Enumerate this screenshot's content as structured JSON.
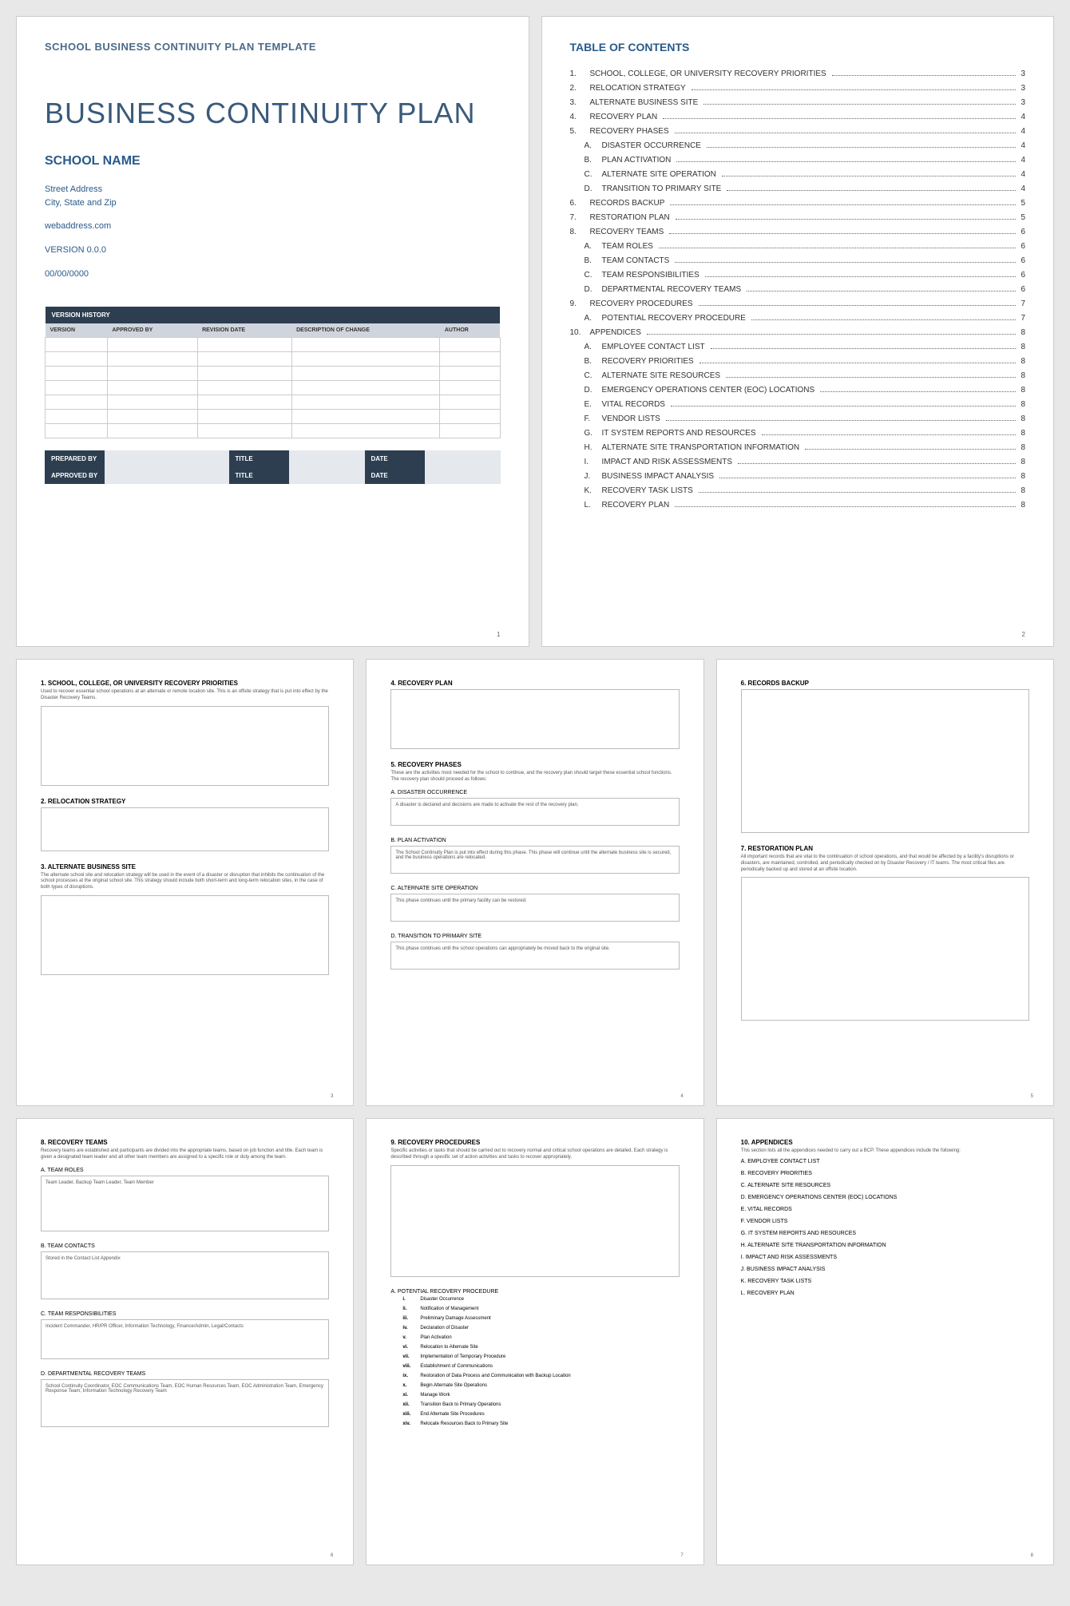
{
  "cover": {
    "template_label": "SCHOOL BUSINESS CONTINUITY PLAN TEMPLATE",
    "title": "BUSINESS CONTINUITY PLAN",
    "school_name": "SCHOOL NAME",
    "address_line1": "Street Address",
    "address_line2": "City, State and Zip",
    "web": "webaddress.com",
    "version": "VERSION 0.0.0",
    "date": "00/00/0000",
    "vh_header": "VERSION HISTORY",
    "vh_cols": [
      "VERSION",
      "APPROVED BY",
      "REVISION DATE",
      "DESCRIPTION OF CHANGE",
      "AUTHOR"
    ],
    "sig": {
      "prepared": "PREPARED BY",
      "approved": "APPROVED BY",
      "title": "TITLE",
      "date": "DATE"
    },
    "page_num": "1"
  },
  "toc": {
    "title": "TABLE OF CONTENTS",
    "items": [
      {
        "n": "1.",
        "t": "SCHOOL, COLLEGE, OR UNIVERSITY RECOVERY PRIORITIES",
        "p": "3"
      },
      {
        "n": "2.",
        "t": "RELOCATION STRATEGY",
        "p": "3"
      },
      {
        "n": "3.",
        "t": "ALTERNATE BUSINESS SITE",
        "p": "3"
      },
      {
        "n": "4.",
        "t": "RECOVERY PLAN",
        "p": "4"
      },
      {
        "n": "5.",
        "t": "RECOVERY PHASES",
        "p": "4"
      },
      {
        "n": "A.",
        "t": "DISASTER OCCURRENCE",
        "p": "4",
        "sub": true
      },
      {
        "n": "B.",
        "t": "PLAN ACTIVATION",
        "p": "4",
        "sub": true
      },
      {
        "n": "C.",
        "t": "ALTERNATE SITE OPERATION",
        "p": "4",
        "sub": true
      },
      {
        "n": "D.",
        "t": "TRANSITION TO PRIMARY SITE",
        "p": "4",
        "sub": true
      },
      {
        "n": "6.",
        "t": "RECORDS BACKUP",
        "p": "5"
      },
      {
        "n": "7.",
        "t": "RESTORATION PLAN",
        "p": "5"
      },
      {
        "n": "8.",
        "t": "RECOVERY TEAMS",
        "p": "6"
      },
      {
        "n": "A.",
        "t": "TEAM ROLES",
        "p": "6",
        "sub": true
      },
      {
        "n": "B.",
        "t": "TEAM CONTACTS",
        "p": "6",
        "sub": true
      },
      {
        "n": "C.",
        "t": "TEAM RESPONSIBILITIES",
        "p": "6",
        "sub": true
      },
      {
        "n": "D.",
        "t": "DEPARTMENTAL RECOVERY TEAMS",
        "p": "6",
        "sub": true
      },
      {
        "n": "9.",
        "t": "RECOVERY PROCEDURES",
        "p": "7"
      },
      {
        "n": "A.",
        "t": "POTENTIAL RECOVERY PROCEDURE",
        "p": "7",
        "sub": true
      },
      {
        "n": "10.",
        "t": "APPENDICES",
        "p": "8"
      },
      {
        "n": "A.",
        "t": "EMPLOYEE CONTACT LIST",
        "p": "8",
        "sub": true
      },
      {
        "n": "B.",
        "t": "RECOVERY PRIORITIES",
        "p": "8",
        "sub": true
      },
      {
        "n": "C.",
        "t": "ALTERNATE SITE RESOURCES",
        "p": "8",
        "sub": true
      },
      {
        "n": "D.",
        "t": "EMERGENCY OPERATIONS CENTER (EOC) LOCATIONS",
        "p": "8",
        "sub": true
      },
      {
        "n": "E.",
        "t": "VITAL RECORDS",
        "p": "8",
        "sub": true
      },
      {
        "n": "F.",
        "t": "VENDOR LISTS",
        "p": "8",
        "sub": true
      },
      {
        "n": "G.",
        "t": "IT SYSTEM REPORTS AND RESOURCES",
        "p": "8",
        "sub": true
      },
      {
        "n": "H.",
        "t": "ALTERNATE SITE TRANSPORTATION INFORMATION",
        "p": "8",
        "sub": true
      },
      {
        "n": "I.",
        "t": "IMPACT AND RISK ASSESSMENTS",
        "p": "8",
        "sub": true
      },
      {
        "n": "J.",
        "t": "BUSINESS IMPACT ANALYSIS",
        "p": "8",
        "sub": true
      },
      {
        "n": "K.",
        "t": "RECOVERY TASK LISTS",
        "p": "8",
        "sub": true
      },
      {
        "n": "L.",
        "t": "RECOVERY PLAN",
        "p": "8",
        "sub": true
      }
    ],
    "page_num": "2"
  },
  "p3": {
    "s1_title": "1. SCHOOL, COLLEGE, OR UNIVERSITY RECOVERY PRIORITIES",
    "s1_desc": "Used to recover essential school operations at an alternate or remote location site. This is an offsite strategy that is put into effect by the Disaster Recovery Teams.",
    "s2_title": "2. RELOCATION STRATEGY",
    "s3_title": "3. ALTERNATE BUSINESS SITE",
    "s3_desc": "The alternate school site and relocation strategy will be used in the event of a disaster or disruption that inhibits the continuation of the school processes at the original school site. This strategy should include both short-term and long-term relocation sites, in the case of both types of disruptions.",
    "page_num": "3"
  },
  "p4": {
    "s4_title": "4. RECOVERY PLAN",
    "s5_title": "5. RECOVERY PHASES",
    "s5_desc": "These are the activities most needed for the school to continue, and the recovery plan should target these essential school functions. The recovery plan should proceed as follows:",
    "a_title": "A. DISASTER OCCURRENCE",
    "a_text": "A disaster is declared and decisions are made to activate the rest of the recovery plan.",
    "b_title": "B. PLAN ACTIVATION",
    "b_text": "The School Continuity Plan is put into effect during this phase. This phase will continue until the alternate business site is secured, and the business operations are relocated.",
    "c_title": "C. ALTERNATE SITE OPERATION",
    "c_text": "This phase continues until the primary facility can be restored.",
    "d_title": "D. TRANSITION TO PRIMARY SITE",
    "d_text": "This phase continues until the school operations can appropriately be moved back to the original site.",
    "page_num": "4"
  },
  "p5": {
    "s6_title": "6. RECORDS BACKUP",
    "s7_title": "7. RESTORATION PLAN",
    "s7_desc": "All important records that are vital to the continuation of school operations, and that would be affected by a facility's disruptions or disasters, are maintained, controlled, and periodically checked on by Disaster Recovery / IT teams. The most critical files are periodically backed up and stored at an offsite location.",
    "page_num": "5"
  },
  "p6": {
    "s8_title": "8. RECOVERY TEAMS",
    "s8_desc": "Recovery teams are established and participants are divided into the appropriate teams, based on job function and title. Each team is given a designated team leader and all other team members are assigned to a specific role or duty among the team.",
    "a_title": "A. TEAM ROLES",
    "a_text": "Team Leader, Backup Team Leader, Team Member",
    "b_title": "B. TEAM CONTACTS",
    "b_text": "Stored in the Contact List Appendix",
    "c_title": "C. TEAM RESPONSIBILITIES",
    "c_text": "Incident Commander, HR/PR Officer, Information Technology, Finance/Admin, Legal/Contacts",
    "d_title": "D. DEPARTMENTAL RECOVERY TEAMS",
    "d_text": "School Continuity Coordinator, EOC Communications Team, EOC Human Resources Team, EOC Administration Team, Emergency Response Team, Information Technology Recovery Team",
    "page_num": "6"
  },
  "p7": {
    "s9_title": "9. RECOVERY PROCEDURES",
    "s9_desc": "Specific activities or tasks that should be carried out to recovery normal and critical school operations are detailed. Each strategy is described through a specific set of action activities and tasks to recover appropriately.",
    "a_title": "A. POTENTIAL RECOVERY PROCEDURE",
    "steps": [
      {
        "n": "i.",
        "t": "Disaster Occurrence"
      },
      {
        "n": "ii.",
        "t": "Notification of Management"
      },
      {
        "n": "iii.",
        "t": "Preliminary Damage Assessment"
      },
      {
        "n": "iv.",
        "t": "Declaration of Disaster"
      },
      {
        "n": "v.",
        "t": "Plan Activation"
      },
      {
        "n": "vi.",
        "t": "Relocation to Alternate Site"
      },
      {
        "n": "vii.",
        "t": "Implementation of Temporary Procedure"
      },
      {
        "n": "viii.",
        "t": "Establishment of Communications"
      },
      {
        "n": "ix.",
        "t": "Restoration of Data Process and Communication with Backup Location"
      },
      {
        "n": "x.",
        "t": "Begin Alternate Site Operations"
      },
      {
        "n": "xi.",
        "t": "Manage Work"
      },
      {
        "n": "xii.",
        "t": "Transition Back to Primary Operations"
      },
      {
        "n": "xiii.",
        "t": "End Alternate Site Procedures"
      },
      {
        "n": "xiv.",
        "t": "Relocate Resources Back to Primary Site"
      }
    ],
    "page_num": "7"
  },
  "p8": {
    "s10_title": "10.    APPENDICES",
    "s10_desc": "This section lists all the appendices needed to carry out a BCP. These appendices include the following:",
    "items": [
      "A. EMPLOYEE CONTACT LIST",
      "B. RECOVERY PRIORITIES",
      "C. ALTERNATE SITE RESOURCES",
      "D. EMERGENCY OPERATIONS CENTER (EOC) LOCATIONS",
      "E. VITAL RECORDS",
      "F. VENDOR LISTS",
      "G. IT SYSTEM REPORTS AND RESOURCES",
      "H. ALTERNATE SITE TRANSPORTATION INFORMATION",
      "I. IMPACT AND RISK ASSESSMENTS",
      "J. BUSINESS IMPACT ANALYSIS",
      "K. RECOVERY TASK LISTS",
      "L. RECOVERY PLAN"
    ],
    "page_num": "8"
  }
}
